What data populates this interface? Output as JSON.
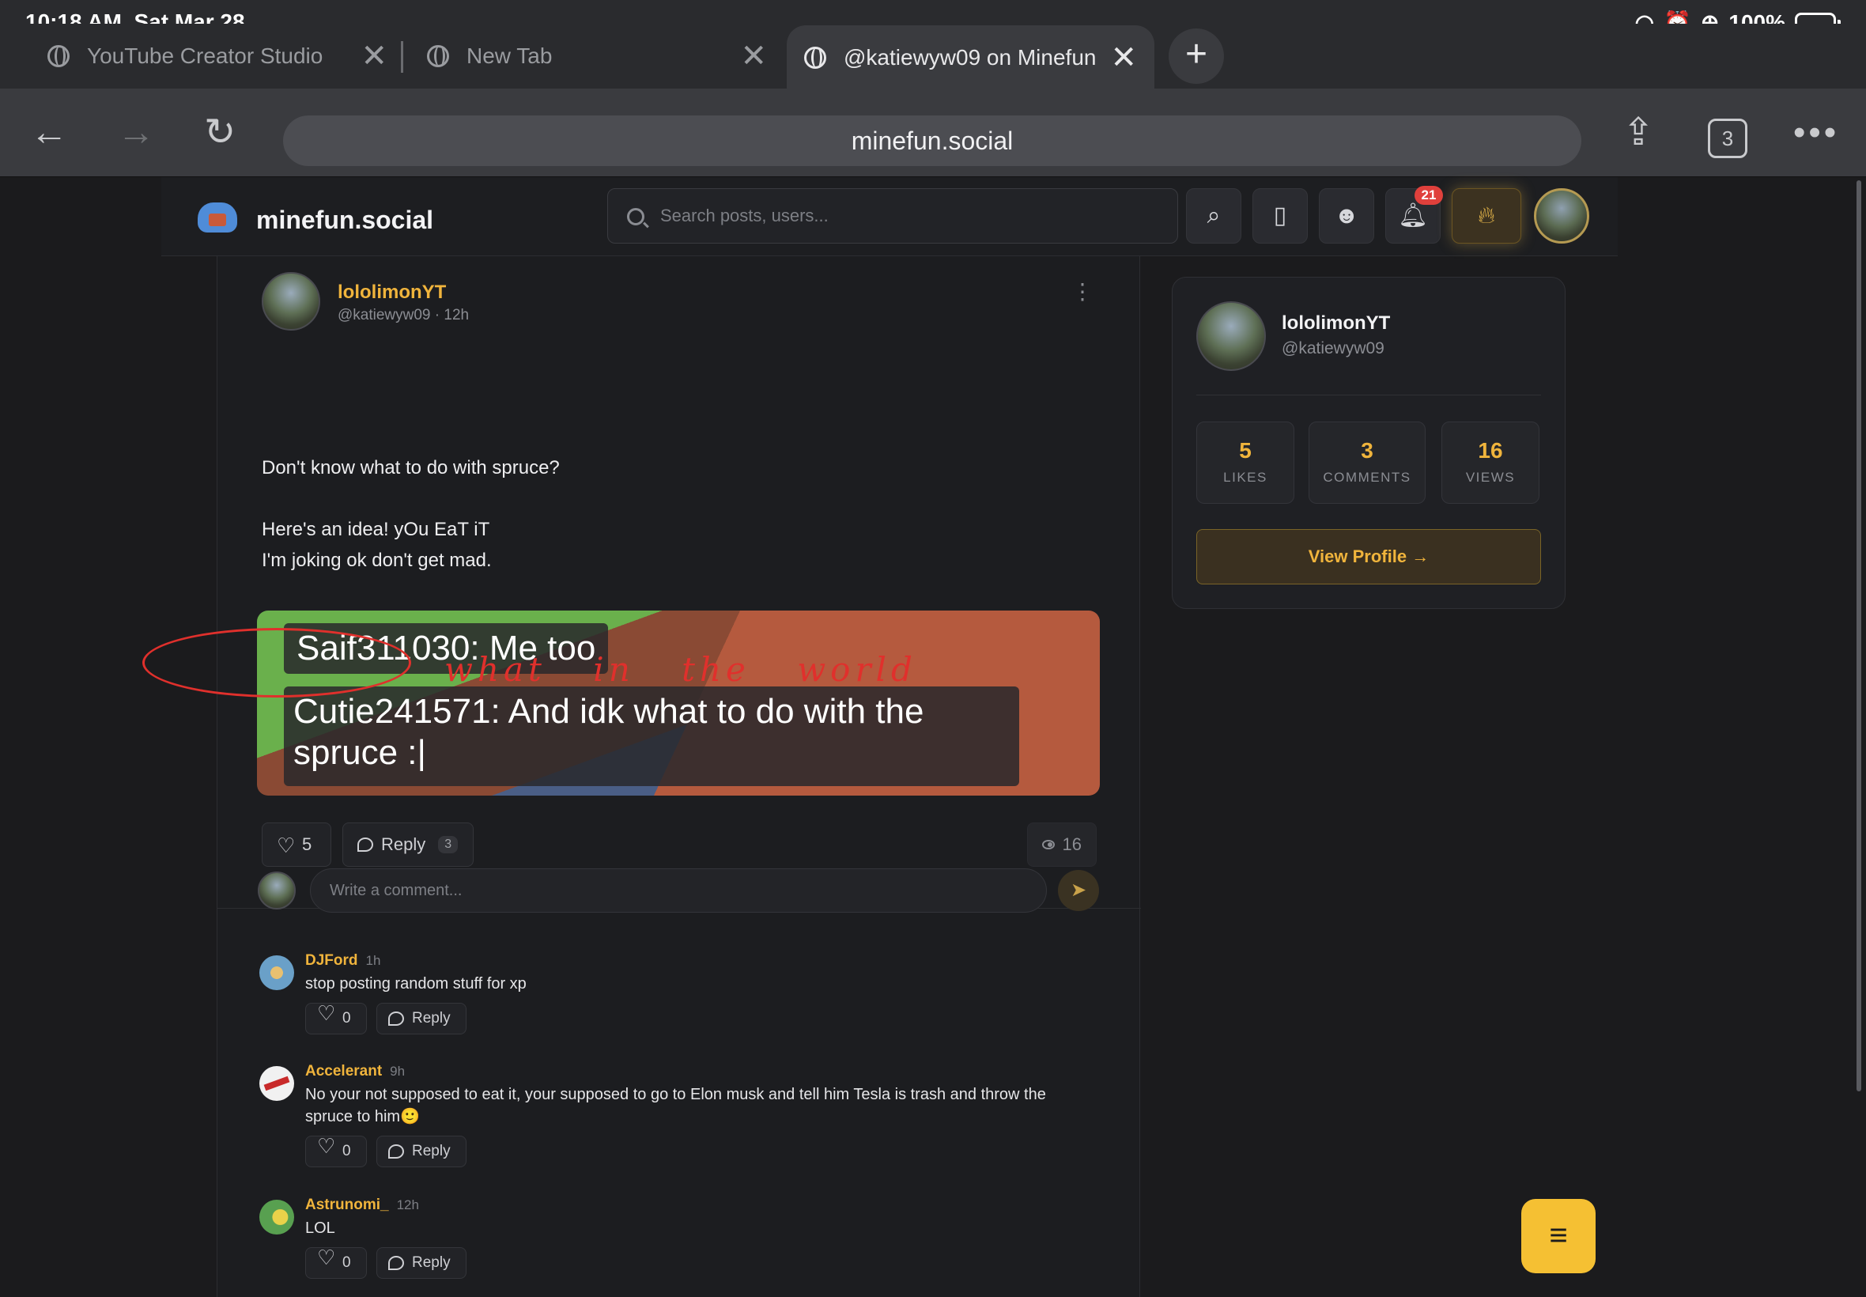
{
  "status": {
    "time": "10:18 AM",
    "date": "Sat Mar 28",
    "battery": "100%"
  },
  "browser": {
    "tabs": [
      {
        "title": "YouTube Creator Studio"
      },
      {
        "title": "New Tab"
      },
      {
        "title": "@katiewyw09 on Minefun"
      }
    ],
    "url": "minefun.social",
    "tab_count": "3"
  },
  "site": {
    "name": "minefun.social",
    "search_placeholder": "Search posts, users...",
    "notification_count": "21"
  },
  "post": {
    "author": "lololimonYT",
    "handle": "@katiewyw09",
    "time": "12h",
    "body": [
      "Don't know what to do with spruce?",
      "",
      "Here's an idea! yOu EaT iT",
      "I'm joking ok don't get mad."
    ],
    "image_chat": [
      "Saif311030: Me too",
      "Cutie241571: And idk what to do with the spruce :|"
    ],
    "likes": "5",
    "reply_label": "Reply",
    "reply_count": "3",
    "views": "16"
  },
  "comment_box": {
    "placeholder": "Write a comment..."
  },
  "comments": [
    {
      "author": "DJFord",
      "time": "1h",
      "text": "stop posting random stuff for xp",
      "likes": "0",
      "reply_label": "Reply"
    },
    {
      "author": "Accelerant",
      "time": "9h",
      "text": "No your not supposed to eat it, your supposed to go to Elon musk and tell him Tesla is trash and throw the spruce to him🙂",
      "likes": "0",
      "reply_label": "Reply"
    },
    {
      "author": "Astrunomi_",
      "time": "12h",
      "text": "LOL",
      "likes": "0",
      "reply_label": "Reply"
    }
  ],
  "annotation": {
    "text": "what in the world",
    "color": "#e0302c"
  },
  "profile_card": {
    "name": "lololimonYT",
    "handle": "@katiewyw09",
    "stats": [
      {
        "value": "5",
        "label": "LIKES"
      },
      {
        "value": "3",
        "label": "COMMENTS"
      },
      {
        "value": "16",
        "label": "VIEWS"
      }
    ],
    "view_profile_label": "View Profile"
  },
  "colors": {
    "accent": "#f0b43c",
    "background": "#1b1b1d",
    "fab": "#f5c033"
  }
}
